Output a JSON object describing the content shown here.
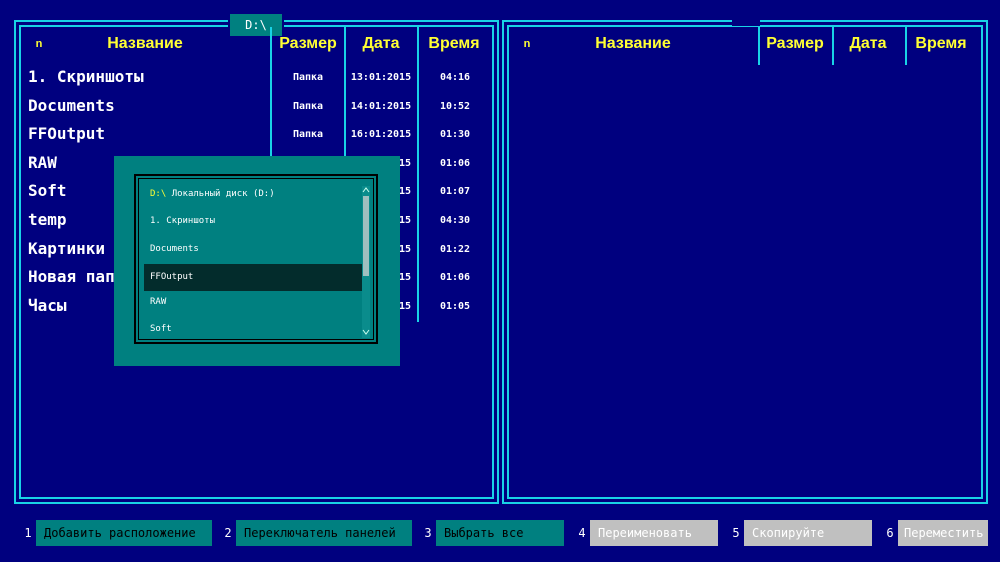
{
  "left_panel": {
    "drive": "D:\\",
    "headers": {
      "n": "n",
      "name": "Название",
      "size": "Размер",
      "date": "Дата",
      "time": "Время"
    },
    "rows": [
      {
        "name": "1. Скриншоты",
        "size": "Папка",
        "date": "13:01:2015",
        "time": "04:16"
      },
      {
        "name": "Documents",
        "size": "Папка",
        "date": "14:01:2015",
        "time": "10:52"
      },
      {
        "name": "FFOutput",
        "size": "Папка",
        "date": "16:01:2015",
        "time": "01:30"
      },
      {
        "name": "RAW",
        "size": "",
        "date": "15",
        "time": "01:06"
      },
      {
        "name": "Soft",
        "size": "",
        "date": "15",
        "time": "01:07"
      },
      {
        "name": "temp",
        "size": "",
        "date": "15",
        "time": "04:30"
      },
      {
        "name": "Картинки",
        "size": "",
        "date": "15",
        "time": "01:22"
      },
      {
        "name": "Новая папк",
        "size": "",
        "date": "15",
        "time": "01:06"
      },
      {
        "name": "Часы",
        "size": "",
        "date": "15",
        "time": "01:05"
      }
    ]
  },
  "right_panel": {
    "headers": {
      "n": "n",
      "name": "Название",
      "size": "Размер",
      "date": "Дата",
      "time": "Время"
    }
  },
  "drive_dialog": {
    "items": [
      {
        "drive": "D:\\",
        "label": "Локальный диск (D:)"
      },
      {
        "drive": "",
        "label": "1. Скриншоты"
      },
      {
        "drive": "",
        "label": "Documents"
      },
      {
        "drive": "",
        "label": "FFOutput",
        "selected": true
      },
      {
        "drive": "",
        "label": "RAW"
      },
      {
        "drive": "",
        "label": "Soft"
      }
    ]
  },
  "function_keys": [
    {
      "num": "1",
      "label": "Добавить расположение",
      "enabled": true
    },
    {
      "num": "2",
      "label": "Переключатель панелей",
      "enabled": true
    },
    {
      "num": "3",
      "label": "Выбрать все",
      "enabled": true
    },
    {
      "num": "4",
      "label": "Переименовать",
      "enabled": false
    },
    {
      "num": "5",
      "label": "Скопируйте",
      "enabled": false
    },
    {
      "num": "6",
      "label": "Переместить",
      "enabled": false
    }
  ],
  "colors": {
    "background": "#00007f",
    "frame": "#19d3e6",
    "header_text": "#ffff33",
    "teal": "#008080",
    "selection": "#032c2c",
    "disabled_button": "#c0c0c0"
  }
}
